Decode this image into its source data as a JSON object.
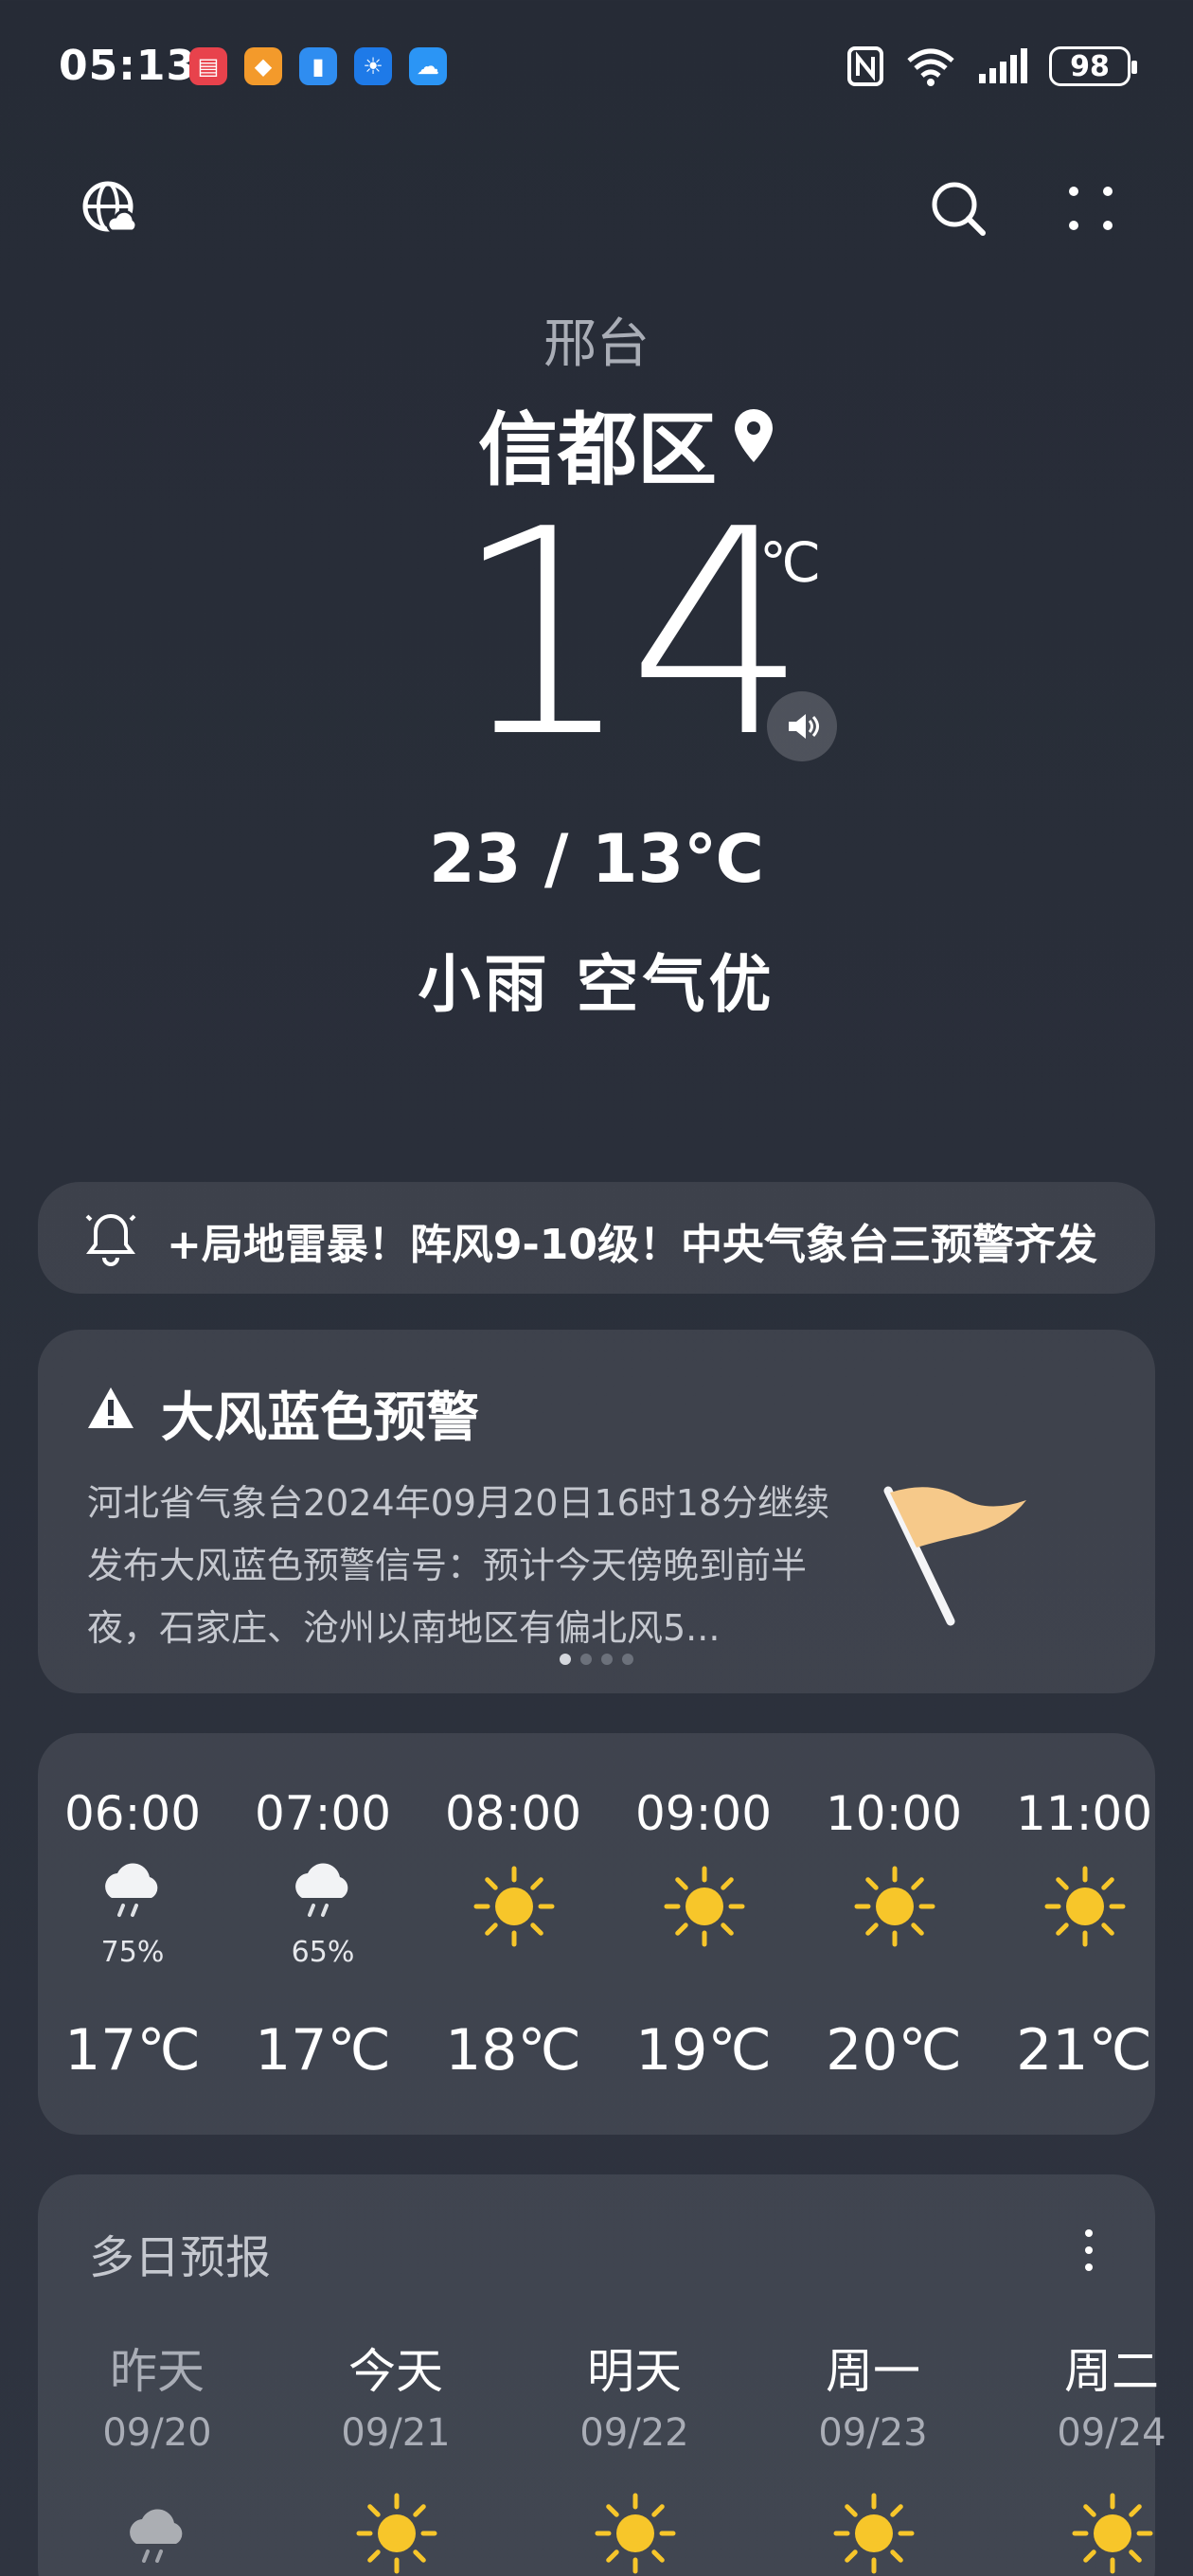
{
  "status_bar": {
    "time": "05:13",
    "battery": "98",
    "icons": [
      "nfc-icon",
      "wifi-icon",
      "signal-icon"
    ]
  },
  "header": {
    "city": "邢台",
    "district": "信都区"
  },
  "current": {
    "temperature": "14",
    "unit": "℃",
    "high_low": "23 / 13℃",
    "condition": "小雨 空气优"
  },
  "news_ticker": {
    "text": "+局地雷暴！阵风9-10级！中央气象台三预警齐发"
  },
  "warning": {
    "title": "大风蓝色预警",
    "body": "河北省气象台2024年09月20日16时18分继续发布大风蓝色预警信号：预计今天傍晚到前半夜，石家庄、沧州以南地区有偏北风5...",
    "pages": 4,
    "active_page": 1
  },
  "hourly": [
    {
      "time": "06:00",
      "icon": "rain-cloud-icon",
      "pop": "75%",
      "temp": "17℃"
    },
    {
      "time": "07:00",
      "icon": "rain-cloud-icon",
      "pop": "65%",
      "temp": "17℃"
    },
    {
      "time": "08:00",
      "icon": "sun-icon",
      "pop": "",
      "temp": "18℃"
    },
    {
      "time": "09:00",
      "icon": "sun-icon",
      "pop": "",
      "temp": "19℃"
    },
    {
      "time": "10:00",
      "icon": "sun-icon",
      "pop": "",
      "temp": "20℃"
    },
    {
      "time": "11:00",
      "icon": "sun-icon",
      "pop": "",
      "temp": "21℃"
    }
  ],
  "daily": {
    "title": "多日预报",
    "days": [
      {
        "name": "昨天",
        "date": "09/20",
        "icon": "rain-cloud-icon"
      },
      {
        "name": "今天",
        "date": "09/21",
        "icon": "sun-icon"
      },
      {
        "name": "明天",
        "date": "09/22",
        "icon": "sun-icon"
      },
      {
        "name": "周一",
        "date": "09/23",
        "icon": "sun-icon"
      },
      {
        "name": "周二",
        "date": "09/24",
        "icon": "sun-icon"
      }
    ]
  },
  "colors": {
    "background": "#262b36",
    "sun": "#f7c62a",
    "flag": "#f6c98a"
  }
}
